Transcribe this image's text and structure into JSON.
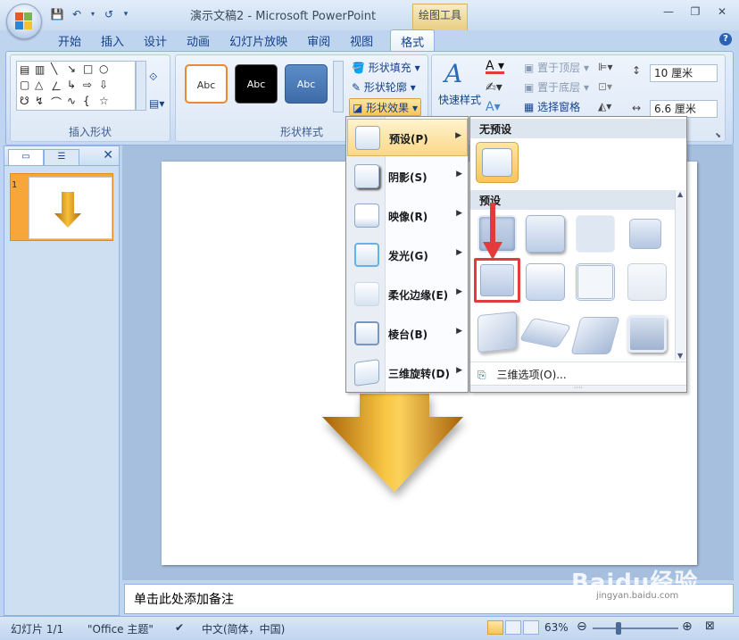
{
  "window": {
    "title": "演示文稿2 - Microsoft PowerPoint",
    "context_tool": "绘图工具"
  },
  "tabs": [
    "开始",
    "插入",
    "设计",
    "动画",
    "幻灯片放映",
    "审阅",
    "视图",
    "格式"
  ],
  "active_tab": "格式",
  "ribbon": {
    "insert_shapes_label": "插入形状",
    "shape_styles_label": "形状样式",
    "style_sample": "Abc",
    "fill": "形状填充",
    "outline": "形状轮廓",
    "effects": "形状效果",
    "quick_styles": "快速样式",
    "bring_front": "置于顶层",
    "send_back": "置于底层",
    "selection_pane": "选择窗格",
    "height": "10 厘米",
    "width": "6.6 厘米"
  },
  "effects_menu": {
    "items": [
      {
        "label": "预设(P)"
      },
      {
        "label": "阴影(S)"
      },
      {
        "label": "映像(R)"
      },
      {
        "label": "发光(G)"
      },
      {
        "label": "柔化边缘(E)"
      },
      {
        "label": "棱台(B)"
      },
      {
        "label": "三维旋转(D)"
      }
    ],
    "no_preset": "无预设",
    "preset": "预设",
    "options_3d": "三维选项(O)..."
  },
  "thumbnail_number": "1",
  "notes_placeholder": "单击此处添加备注",
  "status": {
    "slide": "幻灯片 1/1",
    "theme": "\"Office 主题\"",
    "language": "中文(简体，中国)",
    "zoom": "63%"
  },
  "watermark": "Baidu经验",
  "watermark_url": "jingyan.baidu.com",
  "colors": {
    "accent_orange": "#f7a63a",
    "arrow_gold": "#e8a10e",
    "highlight": "#e33b3b"
  }
}
